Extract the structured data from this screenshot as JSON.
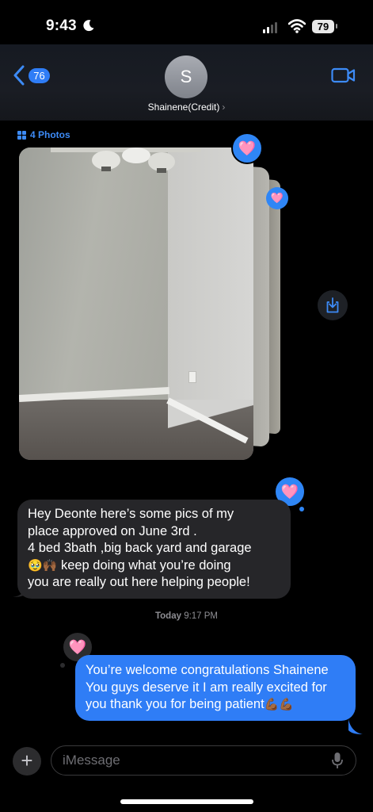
{
  "status_bar": {
    "time": "9:43",
    "battery": "79"
  },
  "header": {
    "back_count": "76",
    "avatar_initial": "S",
    "contact_name": "Shainene(Credit)"
  },
  "photos": {
    "label": "4 Photos"
  },
  "messages": {
    "incoming": {
      "line1": "Hey Deonte here’s some pics of my",
      "line2": "place approved on June 3rd .",
      "line3": "4 bed 3bath ,big back yard and garage",
      "emoji": "🥹🙌🏾",
      "line4": " keep doing what you’re doing",
      "line5": "you are really out here helping people!"
    },
    "timestamp": {
      "day": "Today",
      "time": "9:17 PM"
    },
    "outgoing": {
      "text": "You’re welcome congratulations Shainene You guys deserve it I am really excited for you thank you for being patient",
      "emoji": "💪🏾💪🏾"
    }
  },
  "tapbacks": {
    "heart": "🩷"
  },
  "input": {
    "placeholder": "iMessage"
  },
  "colors": {
    "accent": "#2f7df6",
    "incoming_bubble": "#262629",
    "background": "#000000"
  }
}
